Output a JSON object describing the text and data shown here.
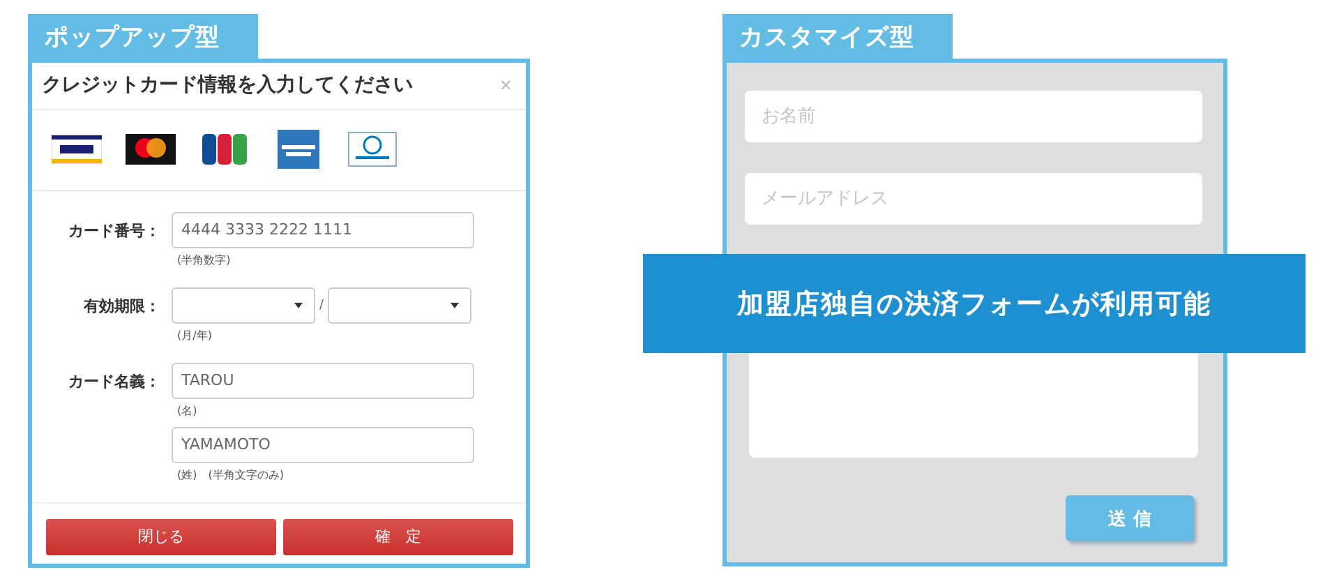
{
  "popup": {
    "tab": "ポップアップ型",
    "title": "クレジットカード情報を入力してください",
    "close": "×",
    "cards": [
      {
        "kind": "visa"
      },
      {
        "kind": "master"
      },
      {
        "kind": "jcb"
      },
      {
        "kind": "amex"
      },
      {
        "kind": "diners"
      }
    ],
    "fields": [
      {
        "kind": "text",
        "label": "カード番号：",
        "inputs": [
          {
            "value": "4444 3333 2222 1111",
            "hint": "(半角数字)"
          }
        ]
      },
      {
        "kind": "select",
        "label": "有効期限：",
        "separator": "/",
        "hint": "(月/年)"
      },
      {
        "kind": "text",
        "label": "カード名義：",
        "inputs": [
          {
            "value": "TAROU",
            "hint": "(名)"
          },
          {
            "value": "YAMAMOTO",
            "hint": "(姓)　(半角文字のみ)"
          }
        ]
      }
    ],
    "buttons": [
      "閉じる",
      "確　定"
    ]
  },
  "custom": {
    "tab": "カスタマイズ型",
    "fields": [
      {
        "kind": "input",
        "placeholder": "お名前"
      },
      {
        "kind": "input",
        "placeholder": "メールアドレス"
      },
      {
        "kind": "textarea"
      }
    ],
    "submit": "送 信"
  },
  "banner": "加盟店独自の決済フォームが利用可能"
}
